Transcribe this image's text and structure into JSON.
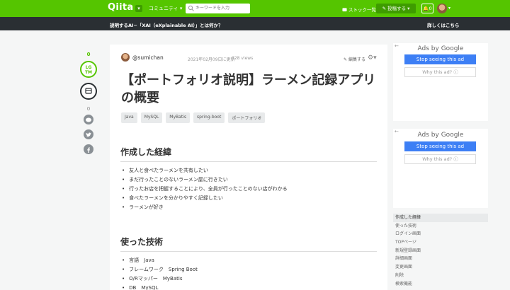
{
  "header": {
    "logo": "Qiita",
    "community": "コミュニティ",
    "search_placeholder": "キーワードを入力",
    "stock_list": "ストック一覧",
    "post_button": "投稿する",
    "notifications": "0",
    "accent": "#55c500"
  },
  "notice": {
    "text": "説明するAI−「XAI（eXplainable AI）」とは何か？",
    "link": "詳しくはこちら"
  },
  "actions": {
    "lgtm_count": "0",
    "lgtm_label": "LG TM",
    "stock_count": "0"
  },
  "article": {
    "author": "@sumichan",
    "date": "2021年02月09日に更新",
    "views": "328 views",
    "edit_request": "編集する",
    "title": "【ポートフォリオ説明】ラーメン記録アプリの概要",
    "tags": [
      "Java",
      "MySQL",
      "MyBatis",
      "spring-boot",
      "ポートフォリオ"
    ],
    "section1": {
      "heading": "作成した経緯",
      "items": [
        "友人と食べたラーメンを共有したい",
        "まだ行ったことのないラーメン屋に行きたい",
        "行ったお店を把握することにより、全員が行ったことのない店がわかる",
        "食べたラーメンを分かりやすく記録したい",
        "ラーメンが好き"
      ]
    },
    "section2": {
      "heading": "使った技術",
      "items": [
        "言語　Java",
        "フレームワーク　Spring Boot",
        "O/Rマッパー　MyBatis",
        "DB　MySQL"
      ]
    }
  },
  "ads": {
    "ads_by": "Ads by Google",
    "stop": "Stop seeing this ad",
    "why": "Why this ad? ⓘ"
  },
  "toc": [
    "作成した経緯",
    "使った技術",
    "ログイン画面",
    "TOPページ",
    "新規登録画面",
    "詳細画面",
    "変更画面",
    "削除",
    "検索機能"
  ]
}
